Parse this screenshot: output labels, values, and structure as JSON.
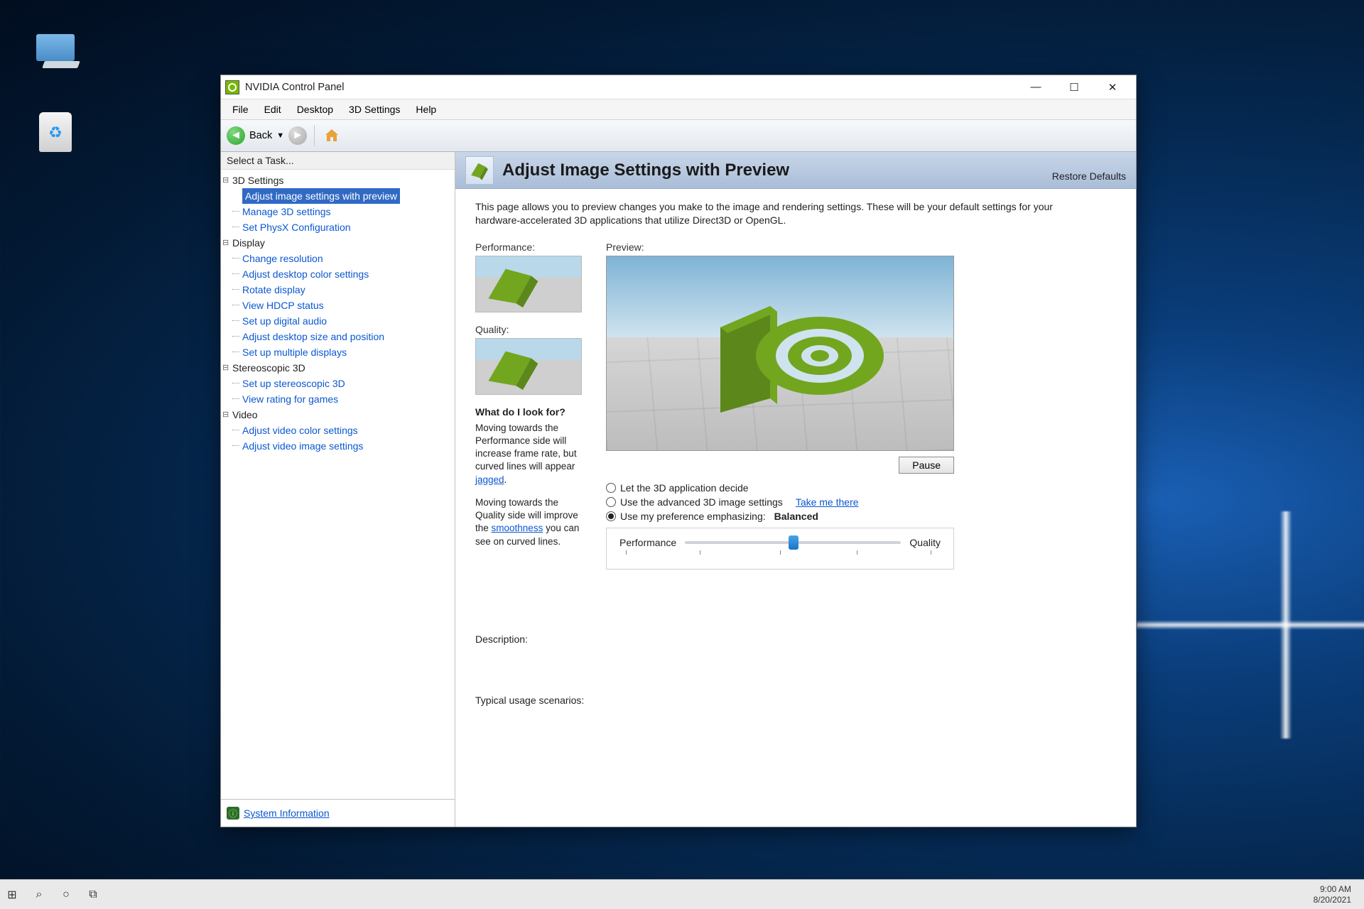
{
  "desktop": {
    "pc_label": "",
    "bin_label": ""
  },
  "window": {
    "title": "NVIDIA Control Panel",
    "menus": [
      "File",
      "Edit",
      "Desktop",
      "3D Settings",
      "Help"
    ],
    "toolbar": {
      "back": "Back"
    }
  },
  "sidebar": {
    "heading": "Select a Task...",
    "groups": [
      {
        "label": "3D Settings",
        "items": [
          "Adjust image settings with preview",
          "Manage 3D settings",
          "Set PhysX Configuration"
        ],
        "selected_index": 0
      },
      {
        "label": "Display",
        "items": [
          "Change resolution",
          "Adjust desktop color settings",
          "Rotate display",
          "View HDCP status",
          "Set up digital audio",
          "Adjust desktop size and position",
          "Set up multiple displays"
        ]
      },
      {
        "label": "Stereoscopic 3D",
        "items": [
          "Set up stereoscopic 3D",
          "View rating for games"
        ]
      },
      {
        "label": "Video",
        "items": [
          "Adjust video color settings",
          "Adjust video image settings"
        ]
      }
    ],
    "sysinfo": "System Information"
  },
  "main": {
    "title": "Adjust Image Settings with Preview",
    "restore": "Restore Defaults",
    "intro": "This page allows you to preview changes you make to the image and rendering settings. These will be your default settings for your hardware-accelerated 3D applications that utilize Direct3D or OpenGL.",
    "perf_label": "Performance:",
    "qual_label": "Quality:",
    "preview_label": "Preview:",
    "pause": "Pause",
    "lookfor_title": "What do I look for?",
    "lookfor_p1a": "Moving towards the Performance side will increase frame rate, but curved lines will appear ",
    "lookfor_link1": "jagged",
    "lookfor_p1b": ".",
    "lookfor_p2a": "Moving towards the Quality side will improve the ",
    "lookfor_link2": "smoothness",
    "lookfor_p2b": " you can see on curved lines.",
    "radios": {
      "r1": "Let the 3D application decide",
      "r2": "Use the advanced 3D image settings",
      "r2_link": "Take me there",
      "r3": "Use my preference emphasizing:",
      "r3_value": "Balanced"
    },
    "slider": {
      "left": "Performance",
      "right": "Quality"
    },
    "desc_label": "Description:",
    "typical_label": "Typical usage scenarios:"
  },
  "taskbar": {
    "time": "9:00 AM",
    "date": "8/20/2021"
  }
}
